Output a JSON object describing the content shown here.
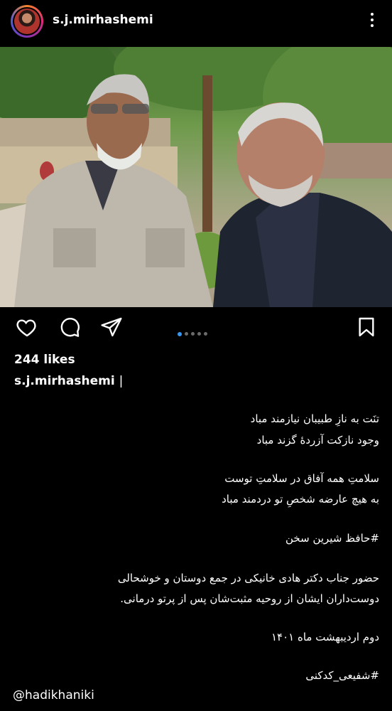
{
  "header": {
    "username": "s.j.mirhashemi"
  },
  "post": {
    "likes": "244 likes",
    "author": "s.j.mirhashemi",
    "cursor": "|",
    "carousel_count": 5,
    "carousel_active": 0,
    "caption_lines": [
      "تنَت به نازِ طبیبان نیازمند مباد",
      "وجود نازکت آزردهٔ گزند مباد",
      "سلامتِ همه آفاق در سلامتِ توست",
      "به هیچ عارضه شخصِ تو دردمند مباد",
      "#حافظ شیرین سخن",
      "حضور جناب دکتر هادی خانیکی در جمع دوستان و خوشحالی",
      "دوست‌داران ایشان از روحیه مثبت‌شان پس از پرتو درمانی.",
      "دوم اردیبهشت ماه ۱۴۰۱",
      "#شفیعی_کدکنی"
    ],
    "mention": "@hadikhaniki"
  },
  "icons": {
    "like": "heart-icon",
    "comment": "comment-icon",
    "share": "paper-plane-icon",
    "save": "bookmark-icon",
    "more": "more-vertical-icon"
  },
  "colors": {
    "background": "#000000",
    "text": "#ffffff",
    "carousel_active": "#3897f0"
  }
}
